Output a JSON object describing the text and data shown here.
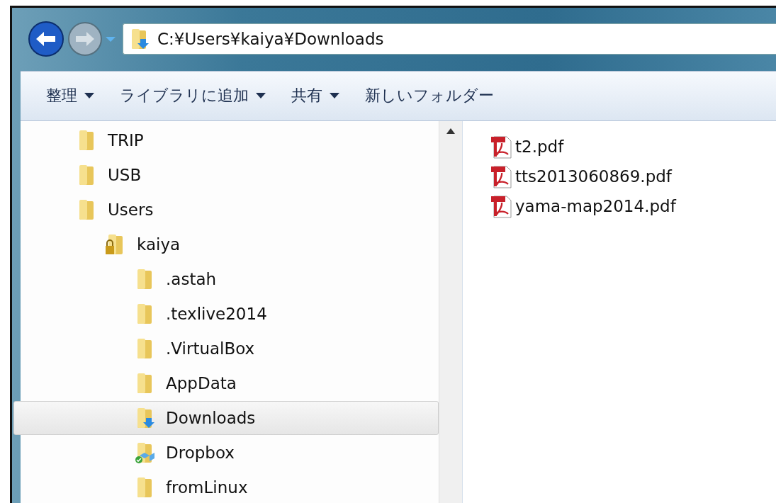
{
  "address_bar": {
    "path": "C:¥Users¥kaiya¥Downloads"
  },
  "toolbar": [
    {
      "label": "整理",
      "dropdown": true
    },
    {
      "label": "ライブラリに追加",
      "dropdown": true
    },
    {
      "label": "共有",
      "dropdown": true
    },
    {
      "label": "新しいフォルダー",
      "dropdown": false
    }
  ],
  "tree": [
    {
      "name": "TRIP",
      "kind": "folder",
      "selected": false
    },
    {
      "name": "USB",
      "kind": "folder",
      "selected": false
    },
    {
      "name": "Users",
      "kind": "folder",
      "selected": false,
      "children": [
        {
          "name": "kaiya",
          "kind": "locked",
          "selected": false,
          "children": [
            {
              "name": ".astah",
              "kind": "folder",
              "selected": false
            },
            {
              "name": ".texlive2014",
              "kind": "folder",
              "selected": false
            },
            {
              "name": ".VirtualBox",
              "kind": "folder",
              "selected": false
            },
            {
              "name": "AppData",
              "kind": "folder",
              "selected": false
            },
            {
              "name": "Downloads",
              "kind": "download",
              "selected": true
            },
            {
              "name": "Dropbox",
              "kind": "dropbox",
              "selected": false
            },
            {
              "name": "fromLinux",
              "kind": "folder",
              "selected": false
            }
          ]
        }
      ]
    }
  ],
  "files": [
    {
      "name": "t2.pdf"
    },
    {
      "name": "tts2013060869.pdf"
    },
    {
      "name": "yama-map2014.pdf"
    }
  ]
}
